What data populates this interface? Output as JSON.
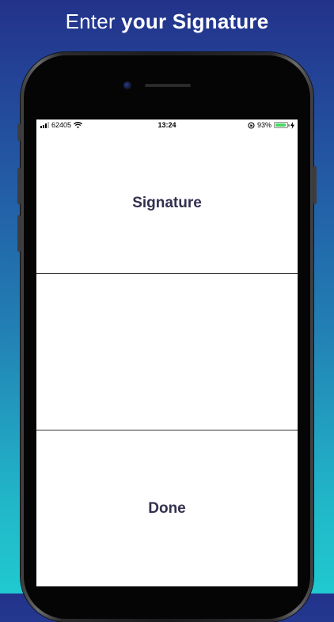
{
  "headline": {
    "light": "Enter ",
    "bold": "your Signature"
  },
  "status_bar": {
    "carrier": "62405",
    "time": "13:24",
    "battery_percent_label": "93%",
    "battery_level": 0.93,
    "icons": [
      "signal-bars-icon",
      "wifi-icon",
      "orientation-lock-icon",
      "battery-icon",
      "charging-bolt-icon"
    ]
  },
  "screen": {
    "title": "Signature",
    "done_label": "Done"
  },
  "colors": {
    "background_top": "#23328a",
    "background_bottom": "#20c9d0",
    "title_text": "#33304f",
    "battery_fill": "#4cd964"
  }
}
